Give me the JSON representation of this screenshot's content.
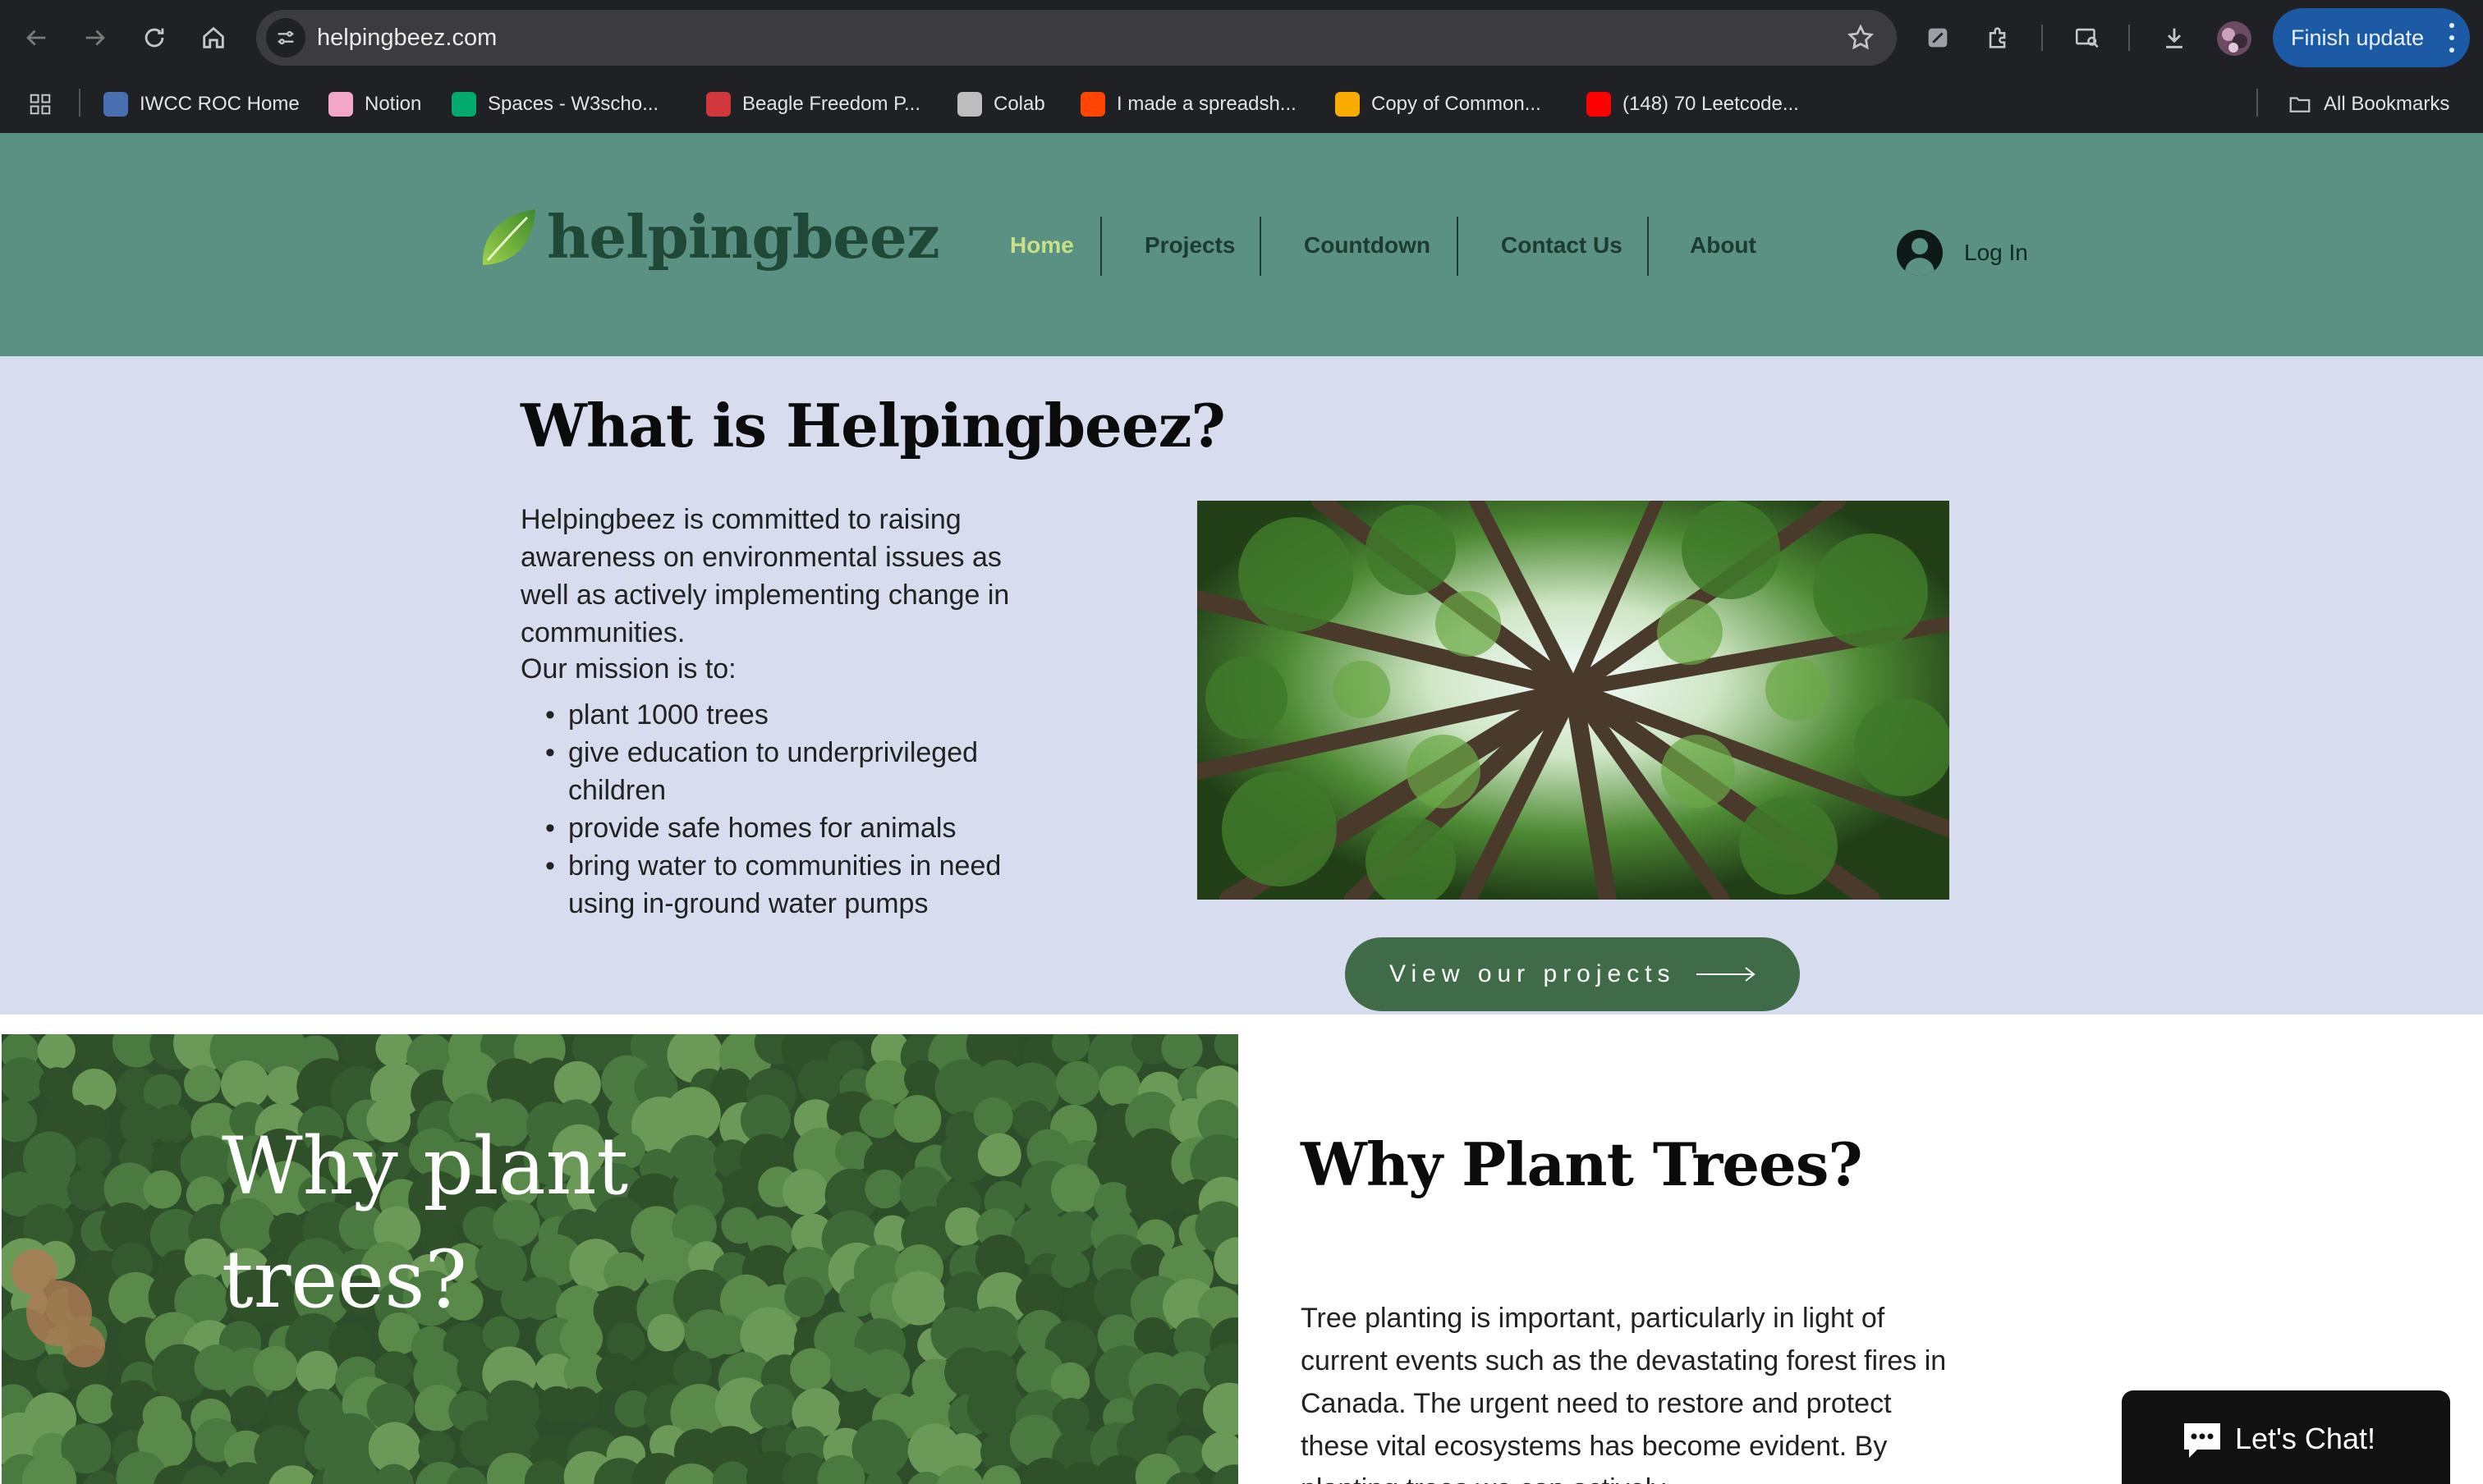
{
  "browser": {
    "url": "helpingbeez.com",
    "update_button": "Finish update",
    "bookmarks": [
      {
        "label": "IWCC ROC Home",
        "icon": "iwcc-icon",
        "color": "#4a6fb0"
      },
      {
        "label": "Notion",
        "icon": "heart-icon",
        "color": "#f4a6c6"
      },
      {
        "label": "Spaces - W3scho...",
        "icon": "w3schools-icon",
        "color": "#04aa6d"
      },
      {
        "label": "Beagle Freedom P...",
        "icon": "paw-icon",
        "color": "#d2373e"
      },
      {
        "label": "Colab",
        "icon": "colab-icon",
        "color": "#bdbdbd"
      },
      {
        "label": "I made a spreadsh...",
        "icon": "reddit-icon",
        "color": "#ff4500"
      },
      {
        "label": "Copy of Common...",
        "icon": "colab-icon",
        "color": "#f9ab00"
      },
      {
        "label": "(148) 70 Leetcode...",
        "icon": "youtube-icon",
        "color": "#ff0000"
      }
    ],
    "all_bookmarks": "All Bookmarks"
  },
  "site": {
    "logo": "helpingbeez",
    "nav": [
      "Home",
      "Projects",
      "Countdown",
      "Contact Us",
      "About"
    ],
    "login": "Log In"
  },
  "what": {
    "title": "What is Helpingbeez?",
    "paragraph": "Helpingbeez is committed to raising awareness on environmental issues as well as actively implementing change in communities.",
    "mission_intro": "Our mission is to:",
    "mission": [
      "plant 1000 trees",
      "give education to underprivileged children",
      "provide safe homes for animals",
      "bring water to communities in need using in-ground water pumps"
    ],
    "cta": "View our projects"
  },
  "why": {
    "image_title": "Why plant trees?",
    "title": "Why Plant Trees?",
    "paragraph": "Tree planting is important, particularly in light of current events such as the devastating forest fires in Canada. The urgent need to restore and protect these vital ecosystems has become evident. By planting trees we can actively"
  },
  "chat": {
    "label": "Let's Chat!"
  },
  "colors": {
    "header_bg": "#5a9182",
    "section_bg": "#d8dcef",
    "cta_bg": "#3f6b48",
    "nav_active": "#c9e08a"
  }
}
